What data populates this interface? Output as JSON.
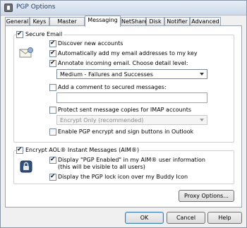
{
  "window": {
    "title": "PGP Options"
  },
  "tabs": [
    {
      "label": "General"
    },
    {
      "label": "Keys"
    },
    {
      "label": "Master Keys"
    },
    {
      "label": "Messaging"
    },
    {
      "label": "NetShare"
    },
    {
      "label": "Disk"
    },
    {
      "label": "Notifier"
    },
    {
      "label": "Advanced"
    }
  ],
  "secure_email": {
    "label": "Secure Email",
    "checked": true,
    "discover": "Discover new accounts",
    "auto_add": "Automatically add my email addresses to my key",
    "annotate": "Annotate incoming email.  Choose detail level:",
    "detail_level": "Medium - Failures and Successes",
    "add_comment": "Add a comment to secured messages:",
    "comment_value": "",
    "protect_imap": "Protect sent message copies for IMAP accounts",
    "imap_mode": "Encrypt Only (recommended)",
    "outlook_buttons": "Enable PGP encrypt and sign buttons in Outlook"
  },
  "aim": {
    "label": "Encrypt AOL® Instant Messages (AIM®)",
    "display_enabled_line1": "Display \"PGP Enabled\" in my AIM® user information",
    "display_enabled_line2": "(this will be visible to all users)",
    "lock_icon": "Display the PGP lock icon over my Buddy Icon"
  },
  "buttons": {
    "proxy": "Proxy Options...",
    "ok": "OK",
    "cancel": "Cancel",
    "help": "Help"
  }
}
